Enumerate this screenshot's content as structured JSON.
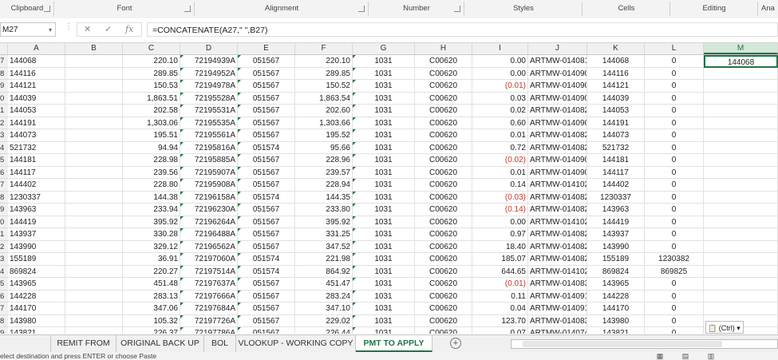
{
  "ribbon": {
    "groups": [
      "Clipboard",
      "Font",
      "Alignment",
      "Number",
      "Styles",
      "Cells",
      "Editing",
      "Ana"
    ]
  },
  "formula_bar": {
    "name_box": "M27",
    "formula": "=CONCATENATE(A27,\" \",B27)"
  },
  "columns": [
    "A",
    "B",
    "C",
    "D",
    "E",
    "F",
    "G",
    "H",
    "I",
    "J",
    "K",
    "L",
    "M"
  ],
  "rows": [
    {
      "n": "7",
      "a": "144068",
      "c": "220.10",
      "d": "72194939A",
      "e": "051567",
      "f": "220.10",
      "g": "1031",
      "h": "C00620",
      "i": "0.00",
      "j": "ARTMW-014081",
      "k": "144068",
      "l": "0",
      "m": "144068"
    },
    {
      "n": "8",
      "a": "144116",
      "c": "289.85",
      "d": "72194952A",
      "e": "051567",
      "f": "289.85",
      "g": "1031",
      "h": "C00620",
      "i": "0.00",
      "j": "ARTMW-014090",
      "k": "144116",
      "l": "0"
    },
    {
      "n": "9",
      "a": "144121",
      "c": "150.53",
      "d": "72194978A",
      "e": "051567",
      "f": "150.52",
      "g": "1031",
      "h": "C00620",
      "i": "(0.01)",
      "neg": true,
      "j": "ARTMW-014090",
      "k": "144121",
      "l": "0"
    },
    {
      "n": "0",
      "a": "144039",
      "c": "1,863.51",
      "d": "72195528A",
      "e": "051567",
      "f": "1,863.54",
      "g": "1031",
      "h": "C00620",
      "i": "0.03",
      "j": "ARTMW-014090",
      "k": "144039",
      "l": "0"
    },
    {
      "n": "1",
      "a": "144053",
      "c": "202.58",
      "d": "72195531A",
      "e": "051567",
      "f": "202.60",
      "g": "1031",
      "h": "C00620",
      "i": "0.02",
      "j": "ARTMW-014082",
      "k": "144053",
      "l": "0"
    },
    {
      "n": "2",
      "a": "144191",
      "c": "1,303.06",
      "d": "72195535A",
      "e": "051567",
      "f": "1,303.66",
      "g": "1031",
      "h": "C00620",
      "i": "0.60",
      "j": "ARTMW-014090",
      "k": "144191",
      "l": "0"
    },
    {
      "n": "3",
      "a": "144073",
      "c": "195.51",
      "d": "72195561A",
      "e": "051567",
      "f": "195.52",
      "g": "1031",
      "h": "C00620",
      "i": "0.01",
      "j": "ARTMW-014082",
      "k": "144073",
      "l": "0"
    },
    {
      "n": "4",
      "a": "521732",
      "c": "94.94",
      "d": "72195816A",
      "e": "051574",
      "f": "95.66",
      "g": "1031",
      "h": "C00620",
      "i": "0.72",
      "j": "ARTMW-014082",
      "k": "521732",
      "l": "0"
    },
    {
      "n": "5",
      "a": "144181",
      "c": "228.98",
      "d": "72195885A",
      "e": "051567",
      "f": "228.96",
      "g": "1031",
      "h": "C00620",
      "i": "(0.02)",
      "neg": true,
      "j": "ARTMW-014090",
      "k": "144181",
      "l": "0"
    },
    {
      "n": "6",
      "a": "144117",
      "c": "239.56",
      "d": "72195907A",
      "e": "051567",
      "f": "239.57",
      "g": "1031",
      "h": "C00620",
      "i": "0.01",
      "j": "ARTMW-014090",
      "k": "144117",
      "l": "0"
    },
    {
      "n": "7",
      "a": "144402",
      "c": "228.80",
      "d": "72195908A",
      "e": "051567",
      "f": "228.94",
      "g": "1031",
      "h": "C00620",
      "i": "0.14",
      "j": "ARTMW-014102",
      "k": "144402",
      "l": "0"
    },
    {
      "n": "8",
      "a": "1230337",
      "c": "144.38",
      "d": "72196158A",
      "e": "051574",
      "f": "144.35",
      "g": "1031",
      "h": "C00620",
      "i": "(0.03)",
      "neg": true,
      "j": "ARTMW-014082",
      "k": "1230337",
      "l": "0"
    },
    {
      "n": "9",
      "a": "143963",
      "c": "233.94",
      "d": "72196230A",
      "e": "051567",
      "f": "233.80",
      "g": "1031",
      "h": "C00620",
      "i": "(0.14)",
      "neg": true,
      "j": "ARTMW-014082",
      "k": "143963",
      "l": "0"
    },
    {
      "n": "0",
      "a": "144419",
      "c": "395.92",
      "d": "72196264A",
      "e": "051567",
      "f": "395.92",
      "g": "1031",
      "h": "C00620",
      "i": "0.00",
      "j": "ARTMW-014102",
      "k": "144419",
      "l": "0"
    },
    {
      "n": "1",
      "a": "143937",
      "c": "330.28",
      "d": "72196488A",
      "e": "051567",
      "f": "331.25",
      "g": "1031",
      "h": "C00620",
      "i": "0.97",
      "j": "ARTMW-014082",
      "k": "143937",
      "l": "0"
    },
    {
      "n": "2",
      "a": "143990",
      "c": "329.12",
      "d": "72196562A",
      "e": "051567",
      "f": "347.52",
      "g": "1031",
      "h": "C00620",
      "i": "18.40",
      "j": "ARTMW-014082",
      "k": "143990",
      "l": "0"
    },
    {
      "n": "3",
      "a": "155189",
      "c": "36.91",
      "d": "72197060A",
      "e": "051574",
      "f": "221.98",
      "g": "1031",
      "h": "C00620",
      "i": "185.07",
      "j": "ARTMW-014082",
      "k": "155189",
      "l": "1230382"
    },
    {
      "n": "4",
      "a": "869824",
      "c": "220.27",
      "d": "72197514A",
      "e": "051574",
      "f": "864.92",
      "g": "1031",
      "h": "C00620",
      "i": "644.65",
      "j": "ARTMW-014102",
      "k": "869824",
      "l": "869825"
    },
    {
      "n": "5",
      "a": "143965",
      "c": "451.48",
      "d": "72197637A",
      "e": "051567",
      "f": "451.47",
      "g": "1031",
      "h": "C00620",
      "i": "(0.01)",
      "neg": true,
      "j": "ARTMW-014083",
      "k": "143965",
      "l": "0"
    },
    {
      "n": "6",
      "a": "144228",
      "c": "283.13",
      "d": "72197666A",
      "e": "051567",
      "f": "283.24",
      "g": "1031",
      "h": "C00620",
      "i": "0.11",
      "j": "ARTMW-014091",
      "k": "144228",
      "l": "0"
    },
    {
      "n": "7",
      "a": "144170",
      "c": "347.06",
      "d": "72197684A",
      "e": "051567",
      "f": "347.10",
      "g": "1031",
      "h": "C00620",
      "i": "0.04",
      "j": "ARTMW-014091",
      "k": "144170",
      "l": "0"
    },
    {
      "n": "8",
      "a": "143980",
      "c": "105.32",
      "d": "72197726A",
      "e": "051567",
      "f": "229.02",
      "g": "1031",
      "h": "C00620",
      "i": "123.70",
      "j": "ARTMW-014083",
      "k": "143980",
      "l": "0"
    },
    {
      "n": "9",
      "a": "143821",
      "c": "226.37",
      "d": "72197786A",
      "e": "051567",
      "f": "226.44",
      "g": "1031",
      "h": "C00620",
      "i": "0.07",
      "j": "ARTMW-014074",
      "k": "143821",
      "l": "0"
    }
  ],
  "paste_options": {
    "label": "(Ctrl)",
    "icon": "clipboard-icon"
  },
  "sheet_tabs": [
    "REMIT FROM",
    "ORIGINAL BACK UP",
    "BOL",
    "VLOOKUP - WORKING COPY",
    "PMT TO APPLY"
  ],
  "active_tab": "PMT TO APPLY",
  "status_text": "elect destination and press ENTER or choose Paste",
  "colors": {
    "accent": "#217346",
    "negative": "#c0392b"
  }
}
